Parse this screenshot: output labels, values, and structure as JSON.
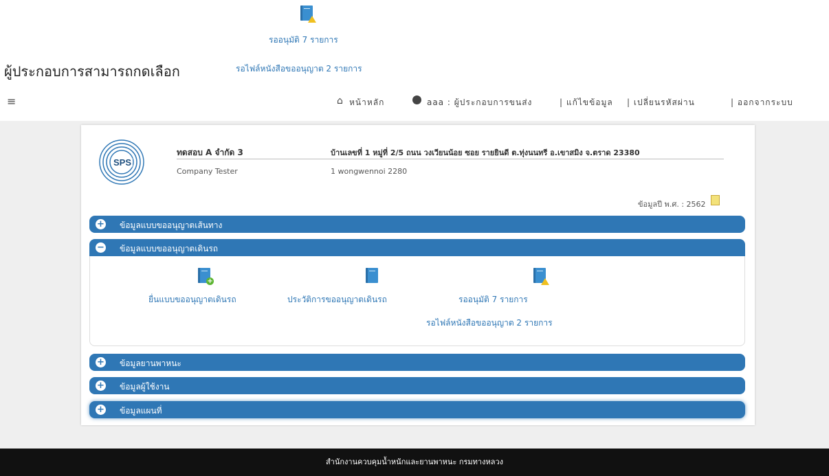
{
  "top_section": {
    "pending_label": "รออนุมัติ 7 รายการ",
    "heading": "ผู้ประกอบการสามารถกดเลือก",
    "pending_file_label": "รอไฟล์หนังสือขออนุญาต 2 รายการ"
  },
  "nav": {
    "menu_icon_glyph": "≡",
    "home_label": "หน้าหลัก",
    "user_label": "aaa : ผู้ประกอบการขนส่ง",
    "edit_label": "| แก้ไขข้อมูล",
    "change_password_label": "| เปลี่ยนรหัสผ่าน",
    "logout_label": "| ออกจากระบบ"
  },
  "company": {
    "logo_text": "SPS",
    "name": "ทดสอบ A จำกัด 3",
    "name_en": "Company Tester",
    "address": "บ้านเลขที่ 1 หมู่ที่ 2/5 ถนน วงเวียนน้อย ซอย รายยินดี ต.ทุ่งนนทรี อ.เขาสมิง จ.ตราด 23380",
    "address_en": "1 wongwennoi 2280",
    "year_label": "ข้อมูลปี พ.ศ. : 2562"
  },
  "accordion": {
    "route_title": "ข้อมูลแบบขออนุญาตเส้นทาง",
    "trip_title": "ข้อมูลแบบขออนุญาตเดินรถ",
    "vehicle_title": "ข้อมูลยานพาหนะ",
    "user_title": "ข้อมูลผู้ใช้งาน",
    "map_title": "ข้อมูลแผนที่",
    "plus_glyph": "+",
    "minus_glyph": "−"
  },
  "trip_panel": {
    "submit_label": "ยื่นแบบขออนุญาตเดินรถ",
    "history_label": "ประวัติการขออนุญาตเดินรถ",
    "pending_label": "รออนุมัติ 7 รายการ",
    "pending_file_label": "รอไฟล์หนังสือขออนุญาต 2 รายการ"
  },
  "footer": {
    "text": "สำนักงานควบคุมน้ำหนักและยานพาหนะ กรมทางหลวง"
  },
  "colors": {
    "primary": "#2f77b5",
    "footer_bg": "#111111",
    "warning": "#f0c020",
    "success": "#5cb531"
  },
  "icons": [
    "menu-icon",
    "home-icon",
    "user-icon",
    "edit-icon",
    "book-icon",
    "book-add-icon",
    "book-warning-icon"
  ]
}
